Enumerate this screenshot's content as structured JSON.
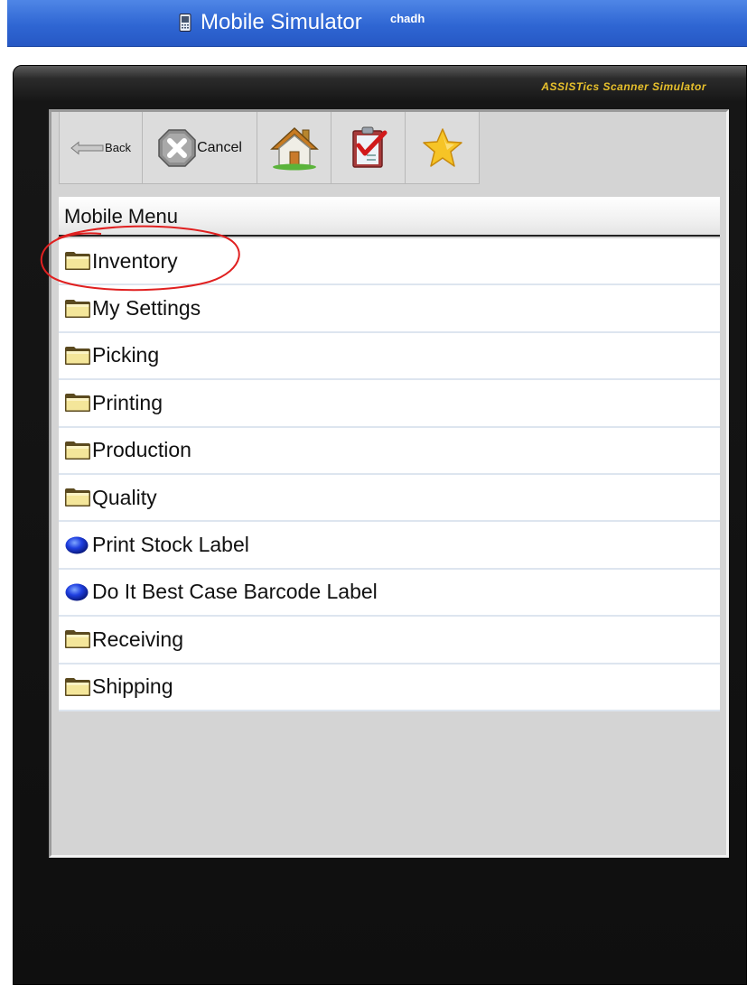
{
  "titlebar": {
    "title": "Mobile Simulator",
    "user": "chadh",
    "icon": "mobile-phone-icon"
  },
  "device": {
    "brand": "ASSISTics Scanner Simulator"
  },
  "toolbar": {
    "back_label": "Back",
    "cancel_label": "Cancel",
    "icons": [
      "back-arrow-icon",
      "cancel-x-icon",
      "home-icon",
      "task-clipboard-icon",
      "favorite-star-icon"
    ]
  },
  "menu": {
    "header": "Mobile Menu",
    "items": [
      {
        "label": "Inventory",
        "icon": "folder-icon"
      },
      {
        "label": "My Settings",
        "icon": "folder-icon"
      },
      {
        "label": "Picking",
        "icon": "folder-icon"
      },
      {
        "label": "Printing",
        "icon": "folder-icon"
      },
      {
        "label": "Production",
        "icon": "folder-icon"
      },
      {
        "label": "Quality",
        "icon": "folder-icon"
      },
      {
        "label": "Print Stock Label",
        "icon": "blue-dot-icon"
      },
      {
        "label": "Do It Best Case Barcode Label",
        "icon": "blue-dot-icon"
      },
      {
        "label": "Receiving",
        "icon": "folder-icon"
      },
      {
        "label": "Shipping",
        "icon": "folder-icon"
      }
    ]
  },
  "colors": {
    "titlebar": "#2f66d3",
    "brand_text": "#e8c12c",
    "annotation": "#e02020"
  }
}
